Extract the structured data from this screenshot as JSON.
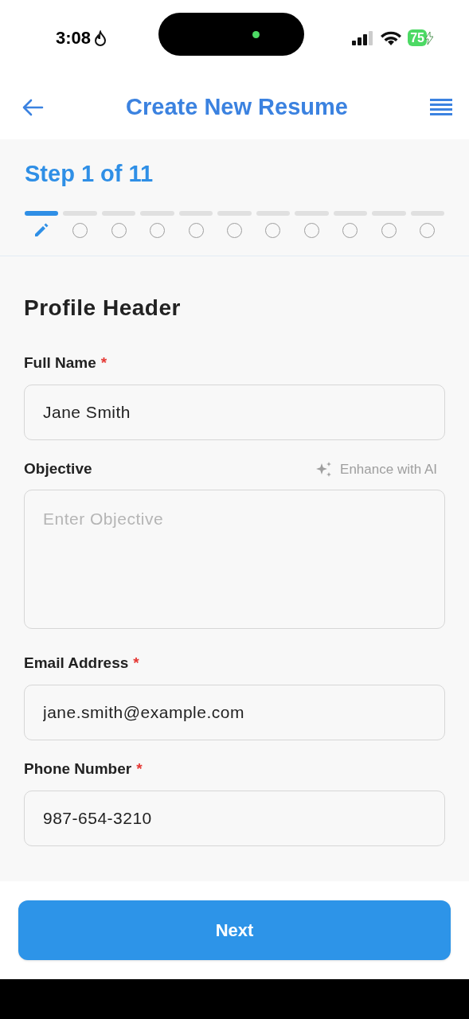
{
  "status_bar": {
    "time": "3:08",
    "battery": "75"
  },
  "header": {
    "title": "Create New Resume"
  },
  "progress": {
    "label": "Step 1 of 11",
    "steps": [
      {
        "selected": true
      },
      {
        "selected": false
      },
      {
        "selected": false
      },
      {
        "selected": false
      },
      {
        "selected": false
      },
      {
        "selected": false
      },
      {
        "selected": false
      },
      {
        "selected": false
      },
      {
        "selected": false
      },
      {
        "selected": false
      },
      {
        "selected": false
      }
    ]
  },
  "section": {
    "title": "Profile Header"
  },
  "fields": [
    {
      "kind": "text",
      "label": "Full Name",
      "required_mark": "*",
      "value": "Jane Smith"
    },
    {
      "kind": "textarea",
      "label": "Objective",
      "placeholder": "Enter Objective",
      "action": "Enhance with AI"
    },
    {
      "kind": "text",
      "label": "Email Address",
      "required_mark": "*",
      "value": "jane.smith@example.com"
    },
    {
      "kind": "text",
      "label": "Phone Number",
      "required_mark": "*",
      "value": "987-654-3210"
    }
  ],
  "footer": {
    "button": "Next"
  }
}
